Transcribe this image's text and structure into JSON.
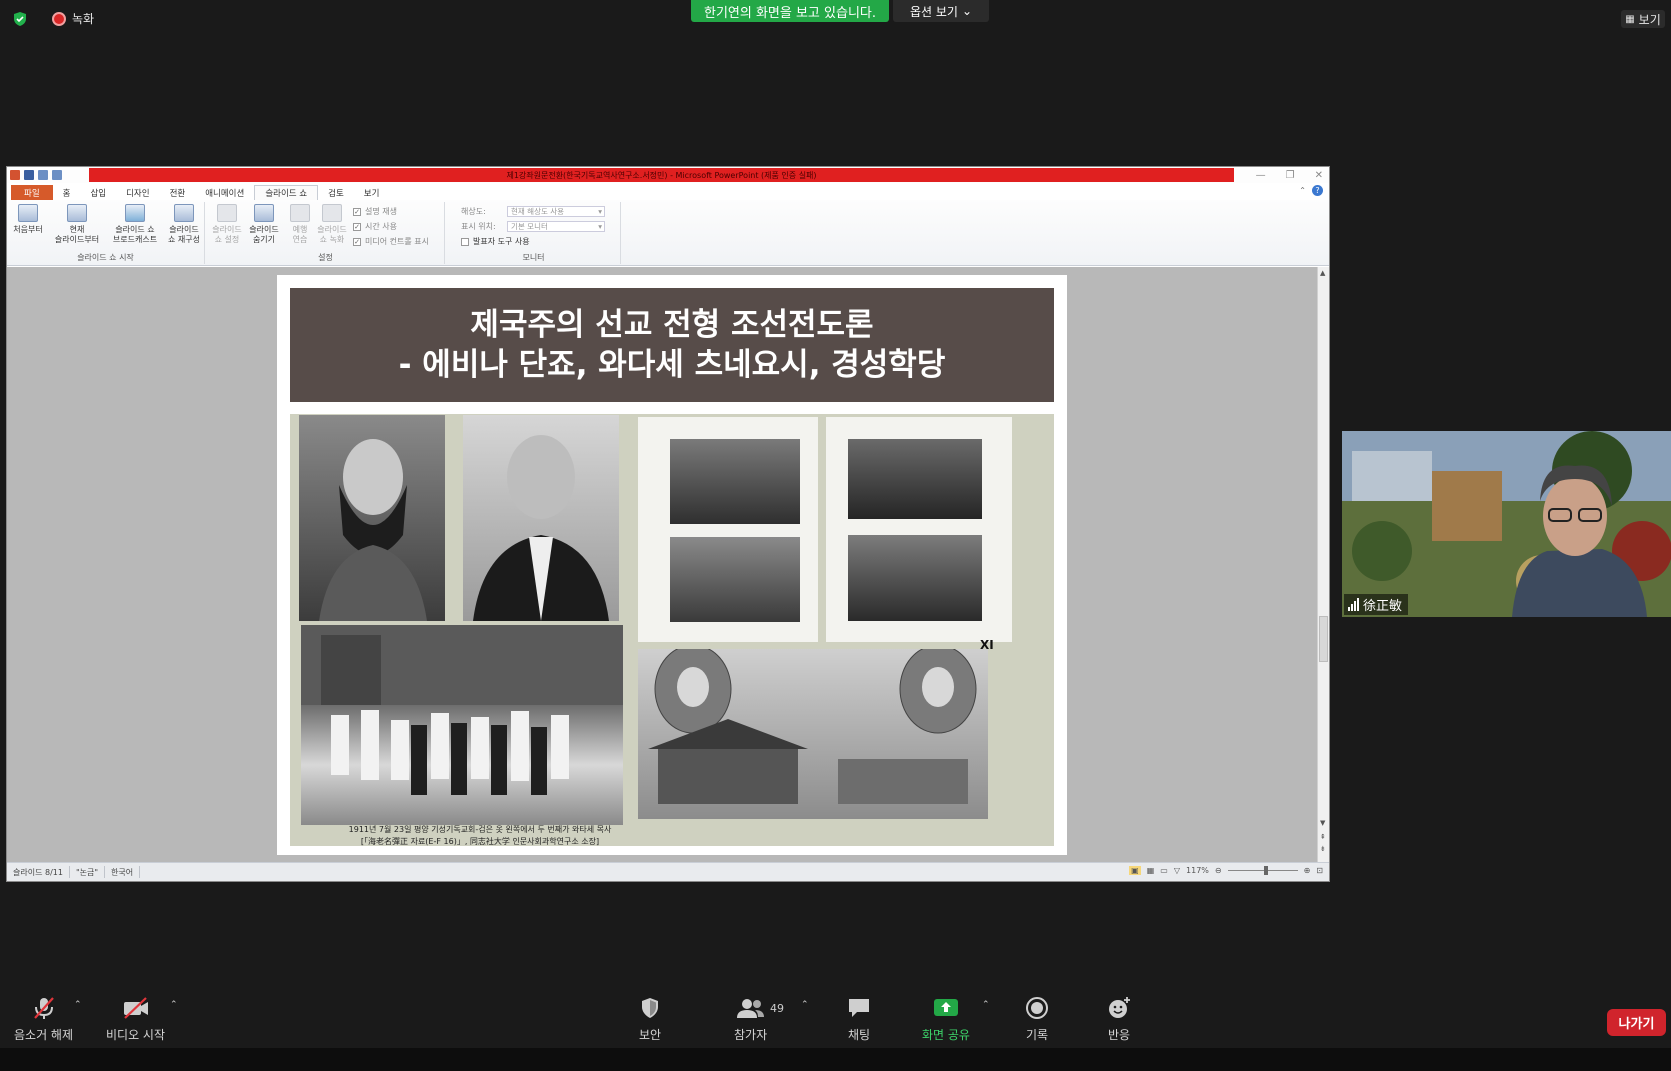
{
  "zoom": {
    "recording_label": "녹화",
    "share_banner": "한기연의 화면을 보고 있습니다.",
    "view_options": "옵션 보기",
    "view_button": "보기"
  },
  "ppt": {
    "window_title": "제1강좌원문전환(한국기독교역사연구소.서정민) - Microsoft PowerPoint (제품 인증 실패)",
    "tabs": [
      "파일",
      "홈",
      "삽입",
      "디자인",
      "전환",
      "애니메이션",
      "슬라이드 쇼",
      "검토",
      "보기"
    ],
    "ribbon": {
      "start_group": {
        "label": "슬라이드 쇼 시작",
        "buttons": [
          "처음부터",
          "현재\n슬라이드부터",
          "슬라이드 쇼\n브로드캐스트",
          "슬라이드\n쇼 재구성"
        ]
      },
      "setup_group": {
        "label": "설정",
        "buttons": [
          "슬라이드\n쇼 설정",
          "슬라이드\n숨기기",
          "예행\n연습",
          "슬라이드\n쇼 녹화"
        ],
        "checks": [
          "설명 재생",
          "시간 사용",
          "미디어 컨트롤 표시"
        ]
      },
      "monitor_group": {
        "label": "모니터",
        "resolution_label": "해상도:",
        "resolution_value": "현재 해상도 사용",
        "show_on_label": "표시 위치:",
        "show_on_value": "기본 모니터",
        "presenter_view": "발표자 도구 사용"
      }
    },
    "status": {
      "slide": "슬라이드 8/11",
      "theme": "\"논금\"",
      "language": "한국어",
      "zoom": "117%"
    }
  },
  "slide": {
    "title_line1": "제국주의 선교 전형 조선전도론",
    "title_line2": "- 에비나 단죠, 와다세 츠네요시, 경성학당",
    "caption_line1": "1911년 7월 23일 평양 기성기독교회-검은 옷 왼쪽에서 두 번째가 와타세 목사",
    "caption_line2": "[「海老名彈正 자료(E-F 16)」, 同志社大学 인문사회과학연구소 소장]",
    "page_mark": "XI"
  },
  "video": {
    "participant_name": "徐正敏"
  },
  "toolbar": {
    "mute": "음소거 해제",
    "video": "비디오 시작",
    "security": "보안",
    "participants": "참가자",
    "participants_count": "49",
    "chat": "채팅",
    "share": "화면 공유",
    "record": "기록",
    "reactions": "반응",
    "leave": "나가기"
  },
  "colors": {
    "share_green": "#23a847",
    "leave_red": "#d0242c",
    "title_box": "#574c49",
    "ppt_title_red": "#e02020"
  }
}
